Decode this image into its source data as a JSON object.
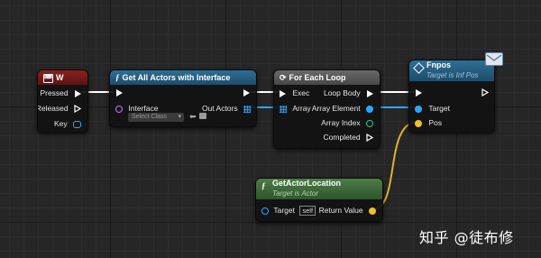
{
  "colors": {
    "event_header": "#7a1a1a",
    "function_header": "#2a5b7a",
    "pure_header": "#3c6a3a",
    "object_pin": "#2aa8ff",
    "vector_pin": "#f0c028",
    "int_pin": "#3ac28f",
    "interface_pin": "#c476ff"
  },
  "nodes": {
    "w": {
      "title": "W",
      "pins": {
        "pressed": "Pressed",
        "released": "Released",
        "key": "Key"
      }
    },
    "get_all": {
      "title": "Get All Actors with Interface",
      "interface_label": "Interface",
      "select_class": "Select Class",
      "out_actors": "Out Actors"
    },
    "foreach": {
      "title": "For Each Loop",
      "exec": "Exec",
      "array": "Array",
      "loop_body": "Loop Body",
      "array_element": "Array Element",
      "array_index": "Array Index",
      "completed": "Completed"
    },
    "fnpos": {
      "title": "Fnpos",
      "subtitle": "Target is Inf Pos",
      "target": "Target",
      "pos": "Pos"
    },
    "get_loc": {
      "title": "GetActorLocation",
      "subtitle": "Target is Actor",
      "target": "Target",
      "self_value": "self",
      "return_value": "Return Value"
    }
  },
  "watermark": "知乎 @徒布修"
}
